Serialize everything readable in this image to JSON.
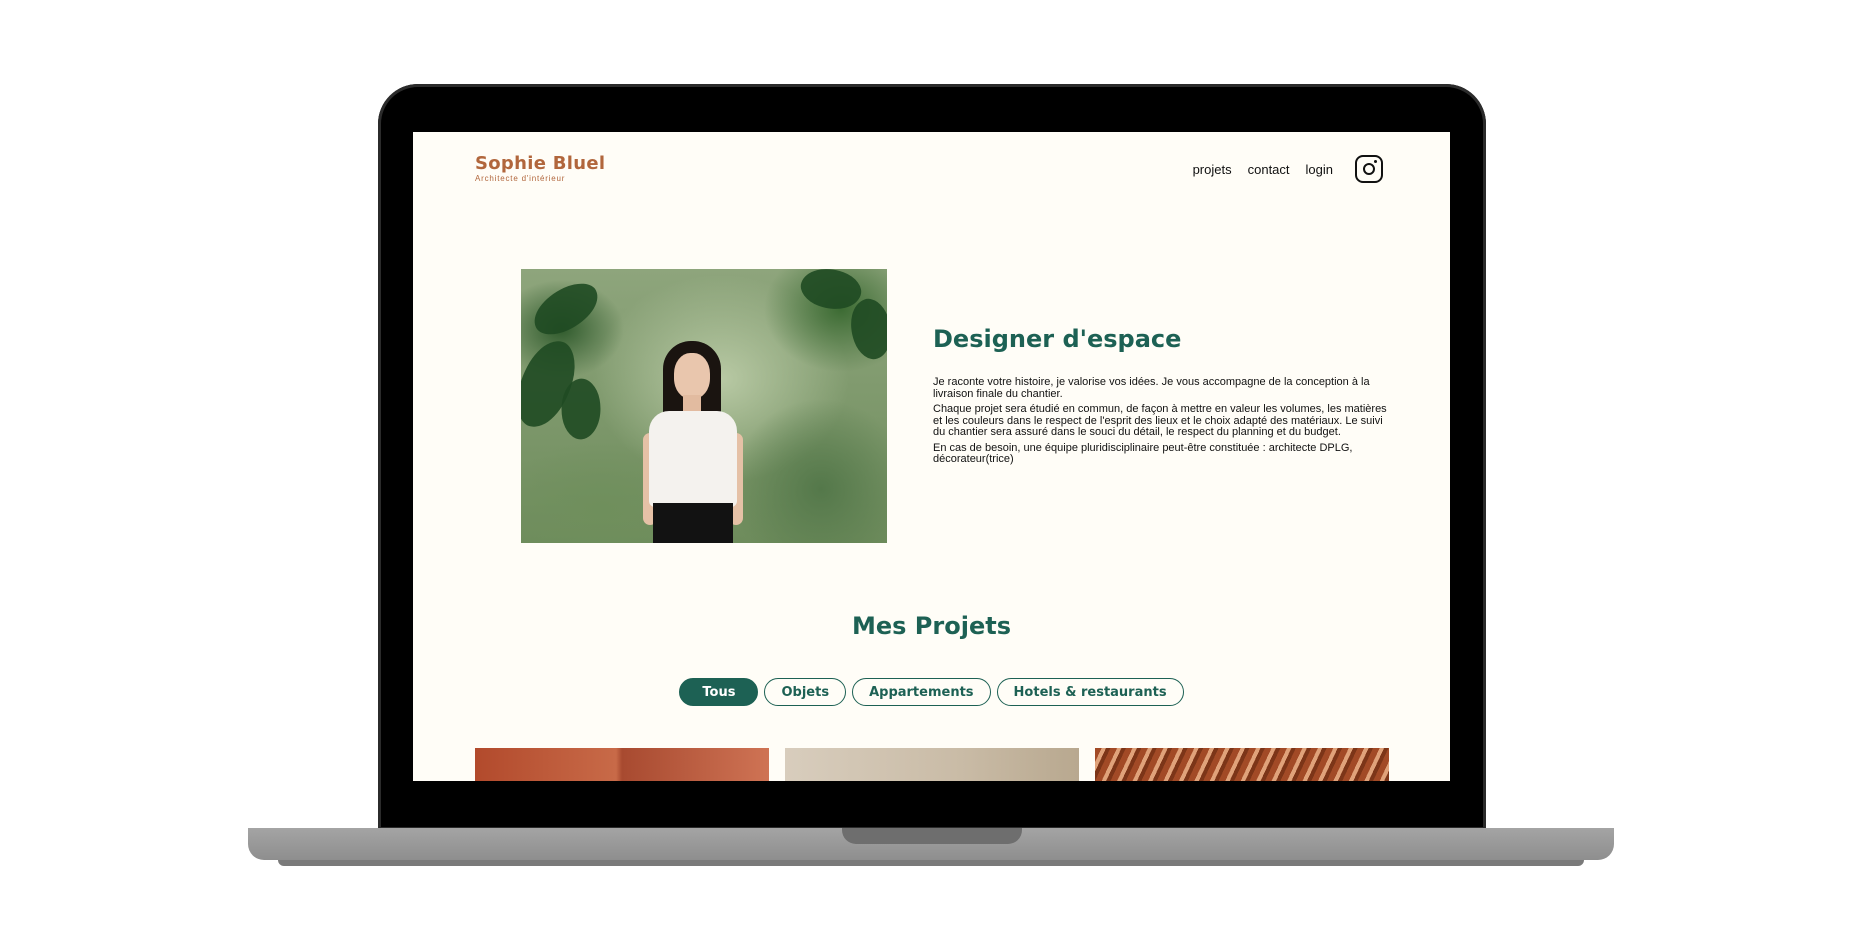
{
  "site": {
    "logo_name": "Sophie Bluel",
    "logo_subtitle": "Architecte d'intérieur"
  },
  "nav": {
    "items": [
      "projets",
      "contact",
      "login"
    ],
    "instagram_icon": "instagram-icon"
  },
  "intro": {
    "title": "Designer d'espace",
    "paragraphs": [
      "Je raconte votre histoire, je valorise vos idées. Je vous accompagne de la conception à la livraison finale du chantier.",
      "Chaque projet sera étudié en commun, de façon à mettre en valeur les volumes, les matières et les couleurs dans le respect de l'esprit des lieux et le choix adapté des matériaux. Le suivi du chantier sera assuré dans le souci du détail, le respect du planning et du budget.",
      "En cas de besoin, une équipe pluridisciplinaire peut-être constituée : architecte DPLG, décorateur(trice)"
    ]
  },
  "projects": {
    "title": "Mes Projets",
    "filters": [
      "Tous",
      "Objets",
      "Appartements",
      "Hotels & restaurants"
    ],
    "active_filter": "Tous"
  },
  "colors": {
    "brand_orange": "#b1663c",
    "brand_green": "#1d6154",
    "page_bg": "#fffdf7"
  }
}
